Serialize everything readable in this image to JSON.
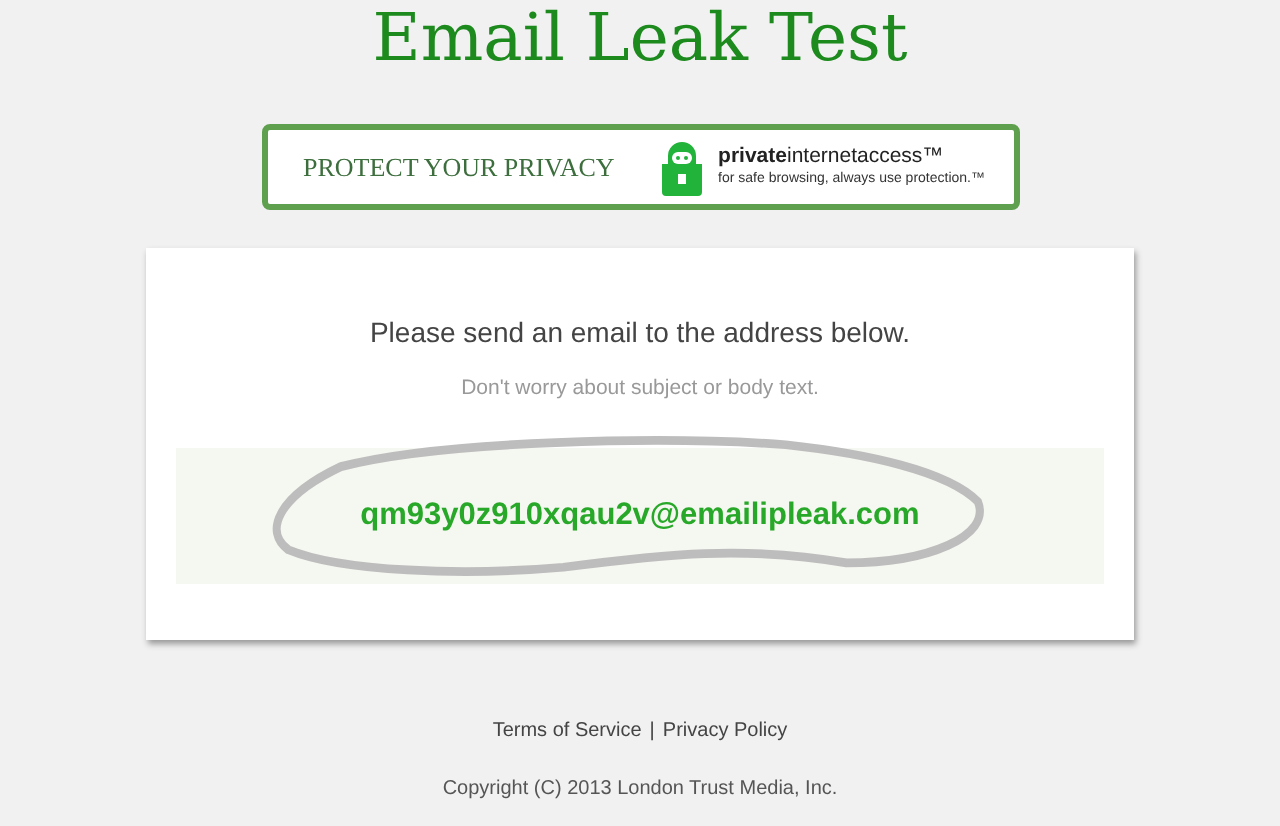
{
  "title": "Email Leak Test",
  "banner": {
    "slogan": "PROTECT YOUR PRIVACY",
    "brand": "**private**internetaccess™",
    "tagline": "for safe browsing, always use protection.™"
  },
  "card": {
    "instruction": "Please send an email to the address below.",
    "hint": "Don't worry about subject or body text.",
    "address": "qm93y0z910xqau2v@emailipleak.com"
  },
  "footer": {
    "links": [
      {
        "label": "Terms of Service"
      },
      {
        "label": "Privacy Policy"
      }
    ],
    "separator": "|",
    "copyright": "Copyright (C) 2013 London Trust Media, Inc."
  }
}
